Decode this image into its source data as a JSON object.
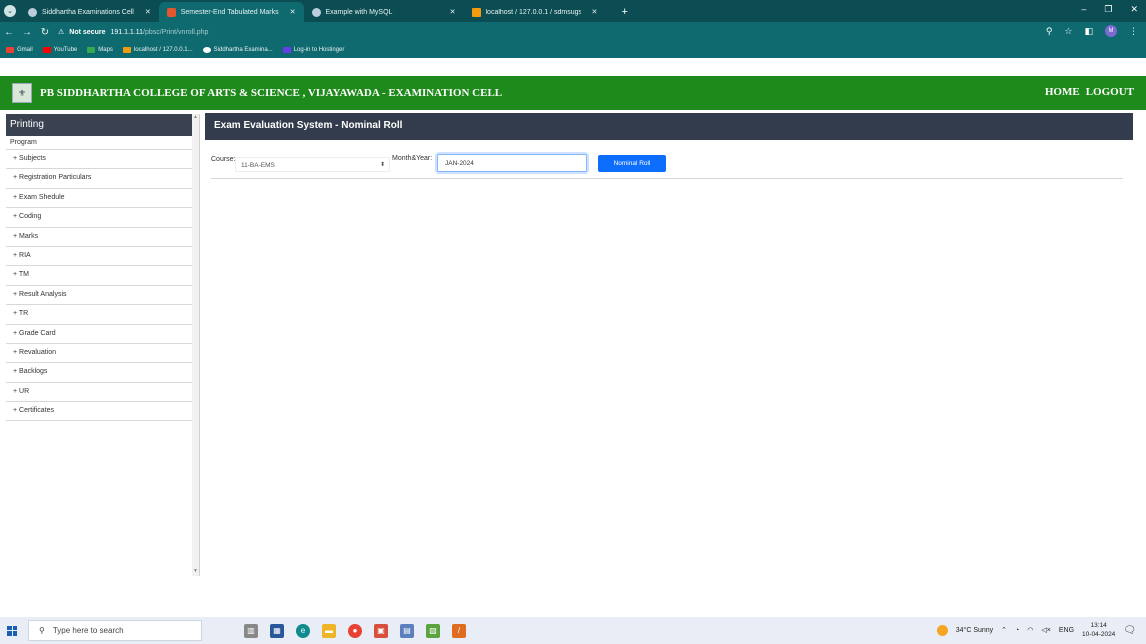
{
  "browser": {
    "tabs": [
      {
        "title": "Siddhartha Examinations Cell",
        "active": false,
        "icon": "globe-icon"
      },
      {
        "title": "Semester-End Tabulated Marks",
        "active": true,
        "icon": "app-icon"
      },
      {
        "title": "Example with MySQL",
        "active": false,
        "icon": "globe-icon"
      },
      {
        "title": "localhost / 127.0.0.1 / sdmsugs",
        "active": false,
        "icon": "phpmyadmin-icon"
      }
    ],
    "new_tab": "+",
    "url_warning": "Not secure",
    "url_host": "191.1.1.11",
    "url_path": "/pbsc/Print/vnroll.php",
    "profile_initial": "M",
    "bookmarks": [
      {
        "label": "Gmail",
        "color": "#ea4335"
      },
      {
        "label": "YouTube",
        "color": "#ff0000"
      },
      {
        "label": "Maps",
        "color": "#34a853"
      },
      {
        "label": "localhost / 127.0.0.1...",
        "color": "#f39c12"
      },
      {
        "label": "Siddhartha Examina...",
        "color": "#ffffff"
      },
      {
        "label": "Log-in to Hostinger",
        "color": "#673de6"
      }
    ]
  },
  "site": {
    "title": "PB SIDDHARTHA COLLEGE OF ARTS & SCIENCE , VIJAYAWADA - EXAMINATION CELL",
    "nav": {
      "home": "HOME",
      "logout": "LOGOUT"
    },
    "header_color": "#1e8a1b"
  },
  "sidebar": {
    "heading": "Printing",
    "items": [
      "Program",
      "+ Subjects",
      "+ Registration Particulars",
      "+ Exam Shedule",
      "+ Coding",
      "+ Marks",
      "+ RIA",
      "+ TM",
      "+ Result Analysis",
      "+ TR",
      "+ Grade Card",
      "+ Revaluation",
      "+ Backlogs",
      "+ UR",
      "+ Certificates"
    ]
  },
  "main": {
    "panel_title": "Exam Evaluation System - Nominal Roll",
    "form": {
      "course_label": "Course:",
      "course_value": "11-BA-EMS",
      "monthyear_label": "Month&Year:",
      "monthyear_value": "JAN-2024",
      "submit_label": "Nominal Roll"
    }
  },
  "taskbar": {
    "search_placeholder": "Type here to search",
    "weather": "34°C  Sunny",
    "lang": "ENG",
    "time": "13:14",
    "date": "10-04-2024"
  }
}
